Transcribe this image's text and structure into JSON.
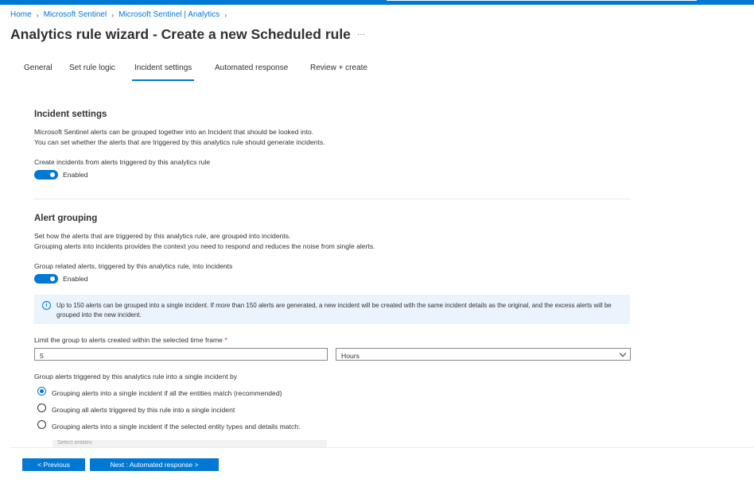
{
  "breadcrumb": [
    "Home",
    "Microsoft Sentinel",
    "Microsoft Sentinel | Analytics"
  ],
  "title": "Analytics rule wizard - Create a new Scheduled rule",
  "more_label": "···",
  "tabs": [
    "General",
    "Set rule logic",
    "Incident settings",
    "Automated response",
    "Review + create"
  ],
  "active_tab": "Incident settings",
  "incident_settings": {
    "heading": "Incident settings",
    "desc1": "Microsoft Sentinel alerts can be grouped together into an Incident that should be looked into.",
    "desc2": "You can set whether the alerts that are triggered by this analytics rule should generate incidents.",
    "toggle_label": "Create incidents from alerts triggered by this analytics rule",
    "toggle_state": "Enabled"
  },
  "alert_grouping": {
    "heading": "Alert grouping",
    "desc1": "Set how the alerts that are triggered by this analytics rule, are grouped into incidents.",
    "desc2": "Grouping alerts into incidents provides the context you need to respond and reduces the noise from single alerts.",
    "toggle_label": "Group related alerts, triggered by this analytics rule, into incidents",
    "toggle_state": "Enabled",
    "info": "Up to 150 alerts can be grouped into a single incident. If more than 150 alerts are generated, a new incident will be created with the same incident details as the original, and the excess alerts will be grouped into the new incident.",
    "timeframe_label": "Limit the group to alerts created within the selected time frame",
    "required_mark": "*",
    "timeframe_value": "5",
    "timeframe_unit": "Hours",
    "group_by_label": "Group alerts triggered by this analytics rule into a single incident by",
    "options": [
      "Grouping alerts into a single incident if all the entities match (recommended)",
      "Grouping all alerts triggered by this rule into a single incident",
      "Grouping alerts into a single incident if the selected entity types and details match:"
    ],
    "selected_option": 0,
    "entity_placeholder": "Select entities"
  },
  "footer": {
    "previous_label": "< Previous",
    "next_label": "Next : Automated response >"
  },
  "colors": {
    "accent": "#0078d4",
    "info_bg": "#ebf3fc",
    "required": "#a4262c"
  }
}
